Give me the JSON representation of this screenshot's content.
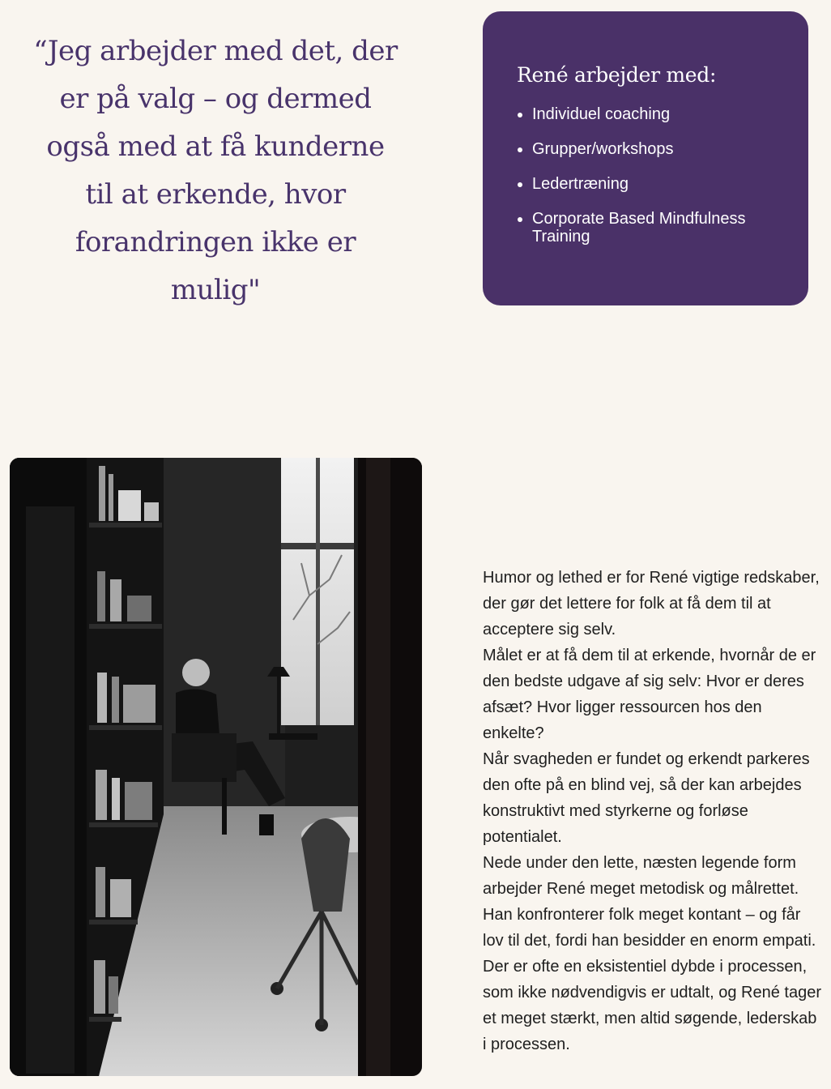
{
  "quote": {
    "text": "“Jeg arbejder med det, der er på valg – og dermed også med at få kunderne til at erkende, hvor forandringen ikke er mulig\""
  },
  "card": {
    "title": "René arbejder med:",
    "items": [
      {
        "label": "Individuel coaching"
      },
      {
        "label": "Grupper/workshops"
      },
      {
        "label": "Ledertræning"
      },
      {
        "label": "Corporate Based Mindfulness Training"
      }
    ]
  },
  "body": {
    "paragraphs": [
      "Humor og lethed er for René vigtige redskaber, der gør det lettere for folk at få dem til at acceptere sig selv.",
      "Målet er at få dem til at erkende, hvornår de er den bedste udgave af sig selv: Hvor er deres afsæt? Hvor ligger ressourcen hos den enkelte?",
      "Når svagheden er fundet og erkendt parkeres den ofte på en blind vej, så der kan arbejdes konstruktivt med styrkerne og forløse potentialet.",
      "Nede under den lette, næsten legende form arbejder René meget metodisk og målrettet. Han konfronterer folk meget kontant – og får lov til det, fordi han besidder en enorm empati.",
      "Der er ofte en eksistentiel dybde i processen, som ikke nødvendigvis er udtalt, og René tager et meget stærkt, men altid søgende, lederskab i processen."
    ]
  },
  "colors": {
    "background": "#f9f5ef",
    "accent": "#4a3168",
    "quote_text": "#48336b",
    "body_text": "#1f1f1f"
  }
}
